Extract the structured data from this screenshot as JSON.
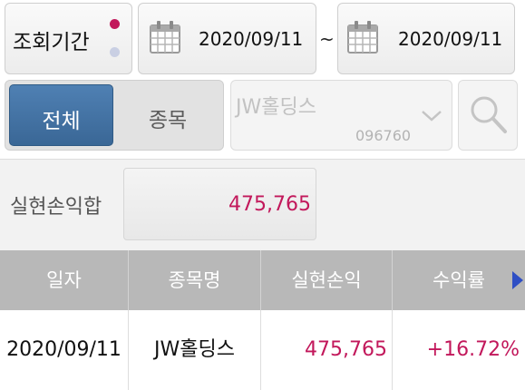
{
  "period": {
    "label": "조회기간",
    "start_date": "2020/09/11",
    "separator": "~",
    "end_date": "2020/09/11"
  },
  "segment": {
    "all_label": "전체",
    "stock_label": "종목",
    "selected": "전체"
  },
  "stock_select": {
    "name": "JW홀딩스",
    "code": "096760"
  },
  "summary": {
    "label": "실현손익합",
    "value": "475,765"
  },
  "table": {
    "columns": [
      "일자",
      "종목명",
      "실현손익",
      "수익률"
    ],
    "rows": [
      {
        "date": "2020/09/11",
        "name": "JW홀딩스",
        "pnl": "475,765",
        "rate": "+16.72%"
      }
    ]
  },
  "colors": {
    "accent": "#c2185b",
    "selected_tab": "#3f6f9f",
    "header_bg": "#b8b8b8",
    "scroll_arrow": "#2f4fc4"
  },
  "icons": [
    "calendar-icon",
    "chevron-down-icon",
    "search-icon",
    "scroll-right-icon"
  ]
}
